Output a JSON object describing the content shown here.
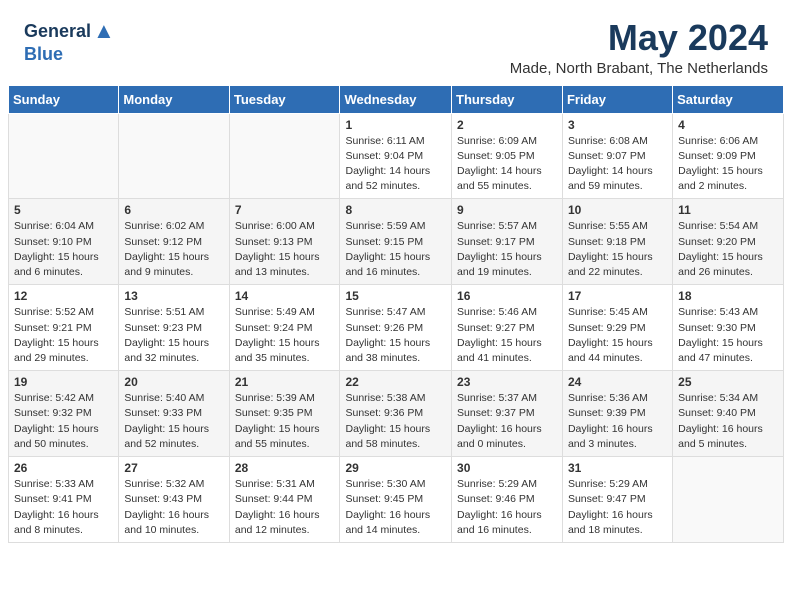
{
  "header": {
    "logo_general": "General",
    "logo_blue": "Blue",
    "month_year": "May 2024",
    "location": "Made, North Brabant, The Netherlands"
  },
  "weekdays": [
    "Sunday",
    "Monday",
    "Tuesday",
    "Wednesday",
    "Thursday",
    "Friday",
    "Saturday"
  ],
  "weeks": [
    [
      {
        "day": "",
        "content": ""
      },
      {
        "day": "",
        "content": ""
      },
      {
        "day": "",
        "content": ""
      },
      {
        "day": "1",
        "content": "Sunrise: 6:11 AM\nSunset: 9:04 PM\nDaylight: 14 hours and 52 minutes."
      },
      {
        "day": "2",
        "content": "Sunrise: 6:09 AM\nSunset: 9:05 PM\nDaylight: 14 hours and 55 minutes."
      },
      {
        "day": "3",
        "content": "Sunrise: 6:08 AM\nSunset: 9:07 PM\nDaylight: 14 hours and 59 minutes."
      },
      {
        "day": "4",
        "content": "Sunrise: 6:06 AM\nSunset: 9:09 PM\nDaylight: 15 hours and 2 minutes."
      }
    ],
    [
      {
        "day": "5",
        "content": "Sunrise: 6:04 AM\nSunset: 9:10 PM\nDaylight: 15 hours and 6 minutes."
      },
      {
        "day": "6",
        "content": "Sunrise: 6:02 AM\nSunset: 9:12 PM\nDaylight: 15 hours and 9 minutes."
      },
      {
        "day": "7",
        "content": "Sunrise: 6:00 AM\nSunset: 9:13 PM\nDaylight: 15 hours and 13 minutes."
      },
      {
        "day": "8",
        "content": "Sunrise: 5:59 AM\nSunset: 9:15 PM\nDaylight: 15 hours and 16 minutes."
      },
      {
        "day": "9",
        "content": "Sunrise: 5:57 AM\nSunset: 9:17 PM\nDaylight: 15 hours and 19 minutes."
      },
      {
        "day": "10",
        "content": "Sunrise: 5:55 AM\nSunset: 9:18 PM\nDaylight: 15 hours and 22 minutes."
      },
      {
        "day": "11",
        "content": "Sunrise: 5:54 AM\nSunset: 9:20 PM\nDaylight: 15 hours and 26 minutes."
      }
    ],
    [
      {
        "day": "12",
        "content": "Sunrise: 5:52 AM\nSunset: 9:21 PM\nDaylight: 15 hours and 29 minutes."
      },
      {
        "day": "13",
        "content": "Sunrise: 5:51 AM\nSunset: 9:23 PM\nDaylight: 15 hours and 32 minutes."
      },
      {
        "day": "14",
        "content": "Sunrise: 5:49 AM\nSunset: 9:24 PM\nDaylight: 15 hours and 35 minutes."
      },
      {
        "day": "15",
        "content": "Sunrise: 5:47 AM\nSunset: 9:26 PM\nDaylight: 15 hours and 38 minutes."
      },
      {
        "day": "16",
        "content": "Sunrise: 5:46 AM\nSunset: 9:27 PM\nDaylight: 15 hours and 41 minutes."
      },
      {
        "day": "17",
        "content": "Sunrise: 5:45 AM\nSunset: 9:29 PM\nDaylight: 15 hours and 44 minutes."
      },
      {
        "day": "18",
        "content": "Sunrise: 5:43 AM\nSunset: 9:30 PM\nDaylight: 15 hours and 47 minutes."
      }
    ],
    [
      {
        "day": "19",
        "content": "Sunrise: 5:42 AM\nSunset: 9:32 PM\nDaylight: 15 hours and 50 minutes."
      },
      {
        "day": "20",
        "content": "Sunrise: 5:40 AM\nSunset: 9:33 PM\nDaylight: 15 hours and 52 minutes."
      },
      {
        "day": "21",
        "content": "Sunrise: 5:39 AM\nSunset: 9:35 PM\nDaylight: 15 hours and 55 minutes."
      },
      {
        "day": "22",
        "content": "Sunrise: 5:38 AM\nSunset: 9:36 PM\nDaylight: 15 hours and 58 minutes."
      },
      {
        "day": "23",
        "content": "Sunrise: 5:37 AM\nSunset: 9:37 PM\nDaylight: 16 hours and 0 minutes."
      },
      {
        "day": "24",
        "content": "Sunrise: 5:36 AM\nSunset: 9:39 PM\nDaylight: 16 hours and 3 minutes."
      },
      {
        "day": "25",
        "content": "Sunrise: 5:34 AM\nSunset: 9:40 PM\nDaylight: 16 hours and 5 minutes."
      }
    ],
    [
      {
        "day": "26",
        "content": "Sunrise: 5:33 AM\nSunset: 9:41 PM\nDaylight: 16 hours and 8 minutes."
      },
      {
        "day": "27",
        "content": "Sunrise: 5:32 AM\nSunset: 9:43 PM\nDaylight: 16 hours and 10 minutes."
      },
      {
        "day": "28",
        "content": "Sunrise: 5:31 AM\nSunset: 9:44 PM\nDaylight: 16 hours and 12 minutes."
      },
      {
        "day": "29",
        "content": "Sunrise: 5:30 AM\nSunset: 9:45 PM\nDaylight: 16 hours and 14 minutes."
      },
      {
        "day": "30",
        "content": "Sunrise: 5:29 AM\nSunset: 9:46 PM\nDaylight: 16 hours and 16 minutes."
      },
      {
        "day": "31",
        "content": "Sunrise: 5:29 AM\nSunset: 9:47 PM\nDaylight: 16 hours and 18 minutes."
      },
      {
        "day": "",
        "content": ""
      }
    ]
  ]
}
